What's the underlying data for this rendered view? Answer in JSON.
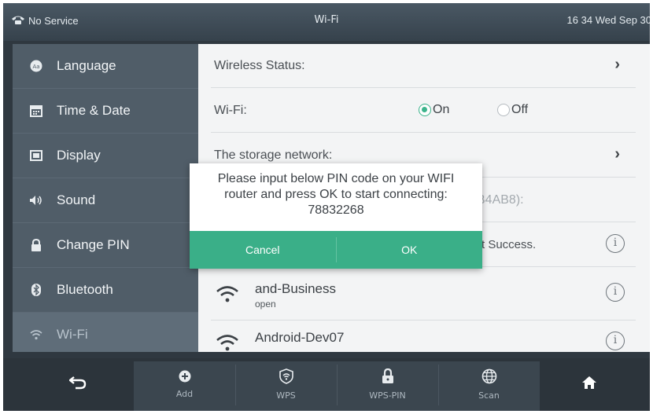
{
  "status_bar": {
    "network": "No Service",
    "title": "Wi-Fi",
    "datetime": "16 34 Wed Sep 30",
    "icons": {
      "network": "phone-handset-icon"
    }
  },
  "sidebar": {
    "items": [
      {
        "label": "Language",
        "icon": "language-icon"
      },
      {
        "label": "Time & Date",
        "icon": "calendar-icon"
      },
      {
        "label": "Display",
        "icon": "display-icon"
      },
      {
        "label": "Sound",
        "icon": "speaker-icon"
      },
      {
        "label": "Change PIN",
        "icon": "lock-icon"
      },
      {
        "label": "Bluetooth",
        "icon": "bluetooth-icon"
      },
      {
        "label": "Wi-Fi",
        "icon": "wifi-icon",
        "active": true
      }
    ]
  },
  "settings": {
    "wireless_status_label": "Wireless Status:",
    "wifi_label": "Wi-Fi:",
    "wifi_on_label": "On",
    "wifi_off_label": "Off",
    "wifi_selected": "On",
    "storage_network_label": "The storage network:",
    "partial_ssid_fragment": "B4AB8):",
    "partial_status_fragment": "t Success."
  },
  "networks": [
    {
      "ssid": "and-Business",
      "security": "open"
    },
    {
      "ssid": "Android-Dev07",
      "security": ""
    }
  ],
  "dialog": {
    "message": "Please input below PIN code on your WIFI router and press OK to start connecting: 78832268",
    "message_line1": "Please input below PIN code on your WIFI",
    "message_line2": "router and press OK to start connecting:",
    "pin": "78832268",
    "cancel_label": "Cancel",
    "ok_label": "OK"
  },
  "softkeys": {
    "back_icon": "back-arrow-icon",
    "add_label": "Add",
    "wps_label": "WPS",
    "wps_pin_label": "WPS-PIN",
    "scan_label": "Scan",
    "home_icon": "home-icon"
  },
  "colors": {
    "accent": "#3aaf88",
    "sidebar_bg": "#505d68",
    "status_bar_bg": "#3f4b55",
    "content_bg": "#f3f4f5"
  }
}
